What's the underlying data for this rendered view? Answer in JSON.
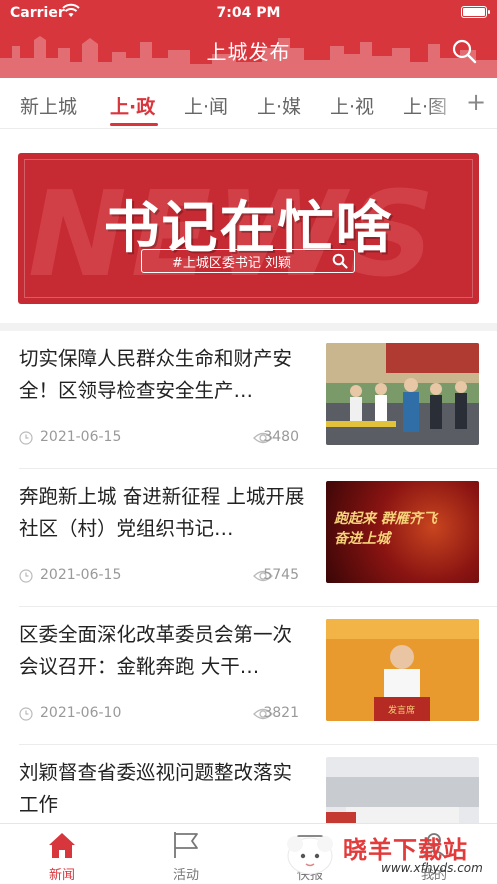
{
  "status_bar": {
    "carrier": "Carrier",
    "time": "7:04 PM"
  },
  "header": {
    "title": "上城发布"
  },
  "tabs": [
    {
      "label": "新上城",
      "active": false
    },
    {
      "label": "上·政",
      "active": true
    },
    {
      "label": "上·闻",
      "active": false
    },
    {
      "label": "上·媒",
      "active": false
    },
    {
      "label": "上·视",
      "active": false
    },
    {
      "label": "上·图",
      "active": false
    }
  ],
  "banner": {
    "background_word": "NEWS",
    "headline": "书记在忙啥",
    "tag": "#上城区委书记 刘颖"
  },
  "news": [
    {
      "title": "切实保障人民群众生命和财产安全！区领导检查安全生产…",
      "date": "2021-06-15",
      "views": "3480",
      "thumb_text": ""
    },
    {
      "title": "奔跑新上城 奋进新征程 上城开展社区（村）党组织书记…",
      "date": "2021-06-15",
      "views": "5745",
      "thumb_text": "跑起来 群雁齐飞 奋进上城"
    },
    {
      "title": "区委全面深化改革委员会第一次会议召开：金靴奔跑 大干…",
      "date": "2021-06-10",
      "views": "3821",
      "thumb_text": "发言席"
    },
    {
      "title": "刘颖督查省委巡视问题整改落实工作",
      "date": "",
      "views": "",
      "thumb_text": ""
    }
  ],
  "tabbar": [
    {
      "label": "新闻",
      "icon": "home-icon",
      "active": true
    },
    {
      "label": "活动",
      "icon": "flag-icon",
      "active": false
    },
    {
      "label": "快报",
      "icon": "mail-icon",
      "active": false
    },
    {
      "label": "我的",
      "icon": "person-icon",
      "active": false
    }
  ],
  "watermark": {
    "brand": "晓羊下载站",
    "url": "www.xfhyds.com"
  },
  "colors": {
    "brand": "#d8363d",
    "text": "#222222",
    "muted": "#999999"
  }
}
